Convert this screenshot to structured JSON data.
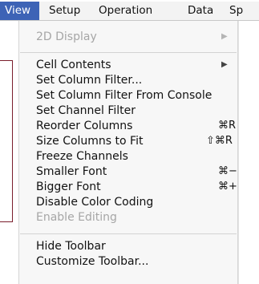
{
  "menubar": {
    "items": [
      {
        "label": "View",
        "active": true
      },
      {
        "label": "Setup",
        "active": false
      },
      {
        "label": "Operation",
        "active": false
      },
      {
        "label": "Data",
        "active": false
      },
      {
        "label": "Sp",
        "active": false
      }
    ]
  },
  "menu": {
    "display_2d": {
      "label": "2D Display",
      "enabled": false,
      "submenu_glyph": "▶"
    },
    "cell_contents": {
      "label": "Cell Contents",
      "enabled": true,
      "submenu_glyph": "▶"
    },
    "set_column_filter": {
      "label": "Set Column Filter...",
      "enabled": true
    },
    "set_column_filter_console": {
      "label": "Set Column Filter From Console",
      "enabled": true
    },
    "set_channel_filter": {
      "label": "Set Channel Filter",
      "enabled": true
    },
    "reorder_columns": {
      "label": "Reorder Columns",
      "enabled": true,
      "shortcut": "⌘R"
    },
    "size_columns": {
      "label": "Size Columns to Fit",
      "enabled": true,
      "shortcut": "⇧⌘R"
    },
    "freeze_channels": {
      "label": "Freeze Channels",
      "enabled": true
    },
    "smaller_font": {
      "label": "Smaller Font",
      "enabled": true,
      "shortcut": "⌘−"
    },
    "bigger_font": {
      "label": "Bigger Font",
      "enabled": true,
      "shortcut": "⌘+"
    },
    "disable_color_coding": {
      "label": "Disable Color Coding",
      "enabled": true
    },
    "enable_editing": {
      "label": "Enable Editing",
      "enabled": false
    },
    "hide_toolbar": {
      "label": "Hide Toolbar",
      "enabled": true
    },
    "customize_toolbar": {
      "label": "Customize Toolbar...",
      "enabled": true
    }
  },
  "colors": {
    "menu_highlight": "#3d63b6",
    "bracket": "#7a1e2c",
    "disabled_text": "#a6a6a6"
  }
}
